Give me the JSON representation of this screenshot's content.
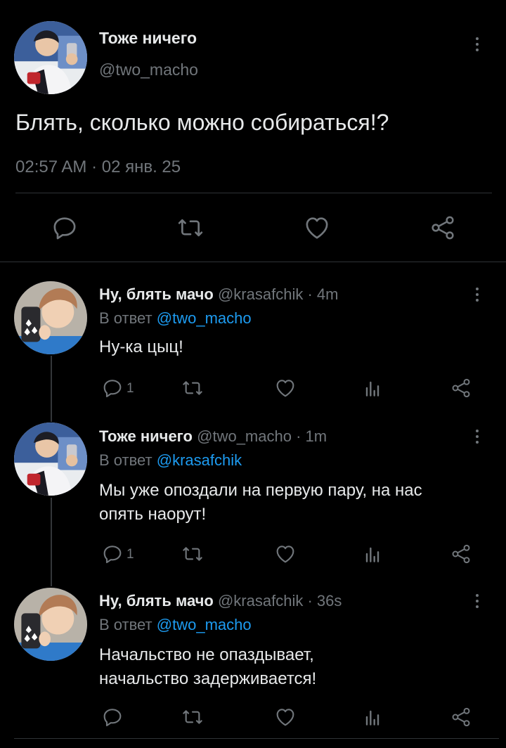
{
  "main_tweet": {
    "author_name": "Тоже ничего",
    "author_handle": "@two_macho",
    "text": "Блять, сколько можно собираться!?",
    "timestamp": "02:57 AM · 02 янв. 25",
    "actions": [
      "reply-icon",
      "retweet-icon",
      "like-icon",
      "share-icon"
    ]
  },
  "replies": [
    {
      "author_name": "Ну, блять мачо",
      "author_handle": "@krasafchik",
      "time": "· 4m",
      "reply_prefix": "В ответ",
      "reply_to": "@two_macho",
      "text_lines": [
        "Ну-ка цыц!"
      ],
      "reply_count": "1"
    },
    {
      "author_name": "Тоже ничего",
      "author_handle": "@two_macho",
      "time": "· 1m",
      "reply_prefix": "В ответ",
      "reply_to": "@krasafchik",
      "text_lines": [
        "Мы уже опоздали на первую пару, на нас",
        "опять наорут!"
      ],
      "reply_count": "1"
    },
    {
      "author_name": "Ну, блять мачо",
      "author_handle": "@krasafchik",
      "time": "· 36s",
      "reply_prefix": "В ответ",
      "reply_to": "@two_macho",
      "text_lines": [
        "Начальство не опаздывает,",
        "начальство задерживается!"
      ],
      "reply_count": ""
    }
  ],
  "colors": {
    "background": "#000000",
    "text": "#e7e9ea",
    "secondary": "#71767b",
    "link": "#1d9bf0",
    "divider": "#2f3336"
  }
}
